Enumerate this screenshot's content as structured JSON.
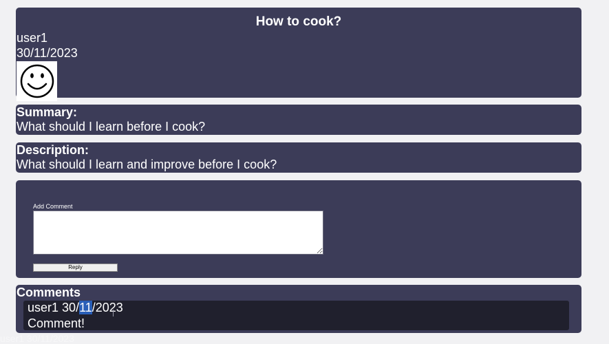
{
  "post": {
    "title": "How to cook?",
    "author": "user1",
    "date": "30/11/2023",
    "avatar_icon": "smiley-face-icon"
  },
  "summary": {
    "heading": "Summary:",
    "text": "What should I learn before I cook?"
  },
  "description": {
    "heading": "Description:",
    "text": "What should I learn and improve before I cook?"
  },
  "add_comment": {
    "label": "Add Comment",
    "value": "",
    "placeholder": "",
    "reply_label": "Reply"
  },
  "comments": {
    "heading": "Comments",
    "items": [
      {
        "author": "user1",
        "date_before_selection": "30/",
        "date_selected": "11",
        "date_after_selection": "/2023",
        "text": "Comment!"
      }
    ]
  },
  "ghost_overlay_text": "user1 30/11/2023",
  "colors": {
    "page_background": "#f1f1f3",
    "panel_background": "#3c3c58",
    "comment_background": "#20202d",
    "selection_highlight": "#2a5fb8",
    "text": "#ffffff"
  }
}
